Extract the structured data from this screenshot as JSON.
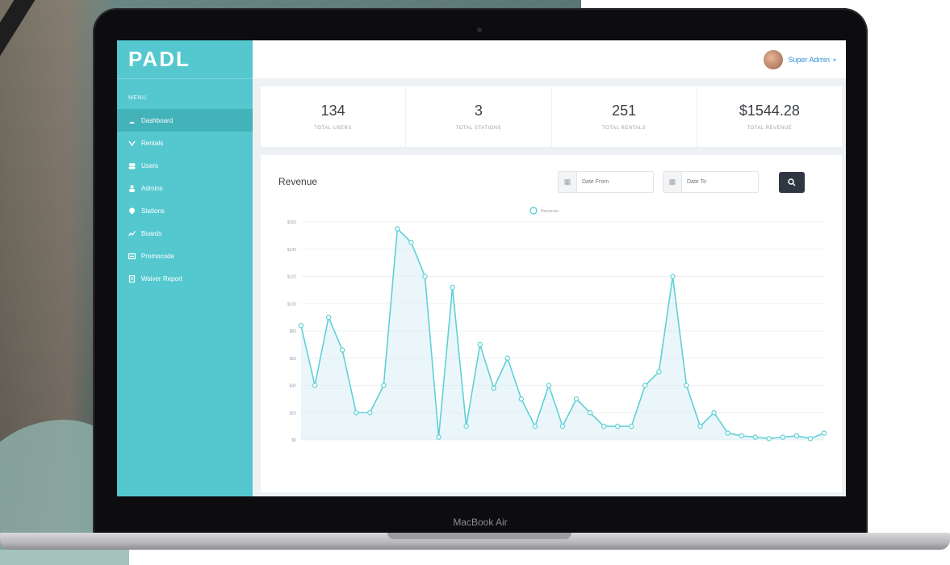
{
  "device": {
    "label": "MacBook Air"
  },
  "sidebar": {
    "logo": "PADL",
    "menu_title": "MENU",
    "items": [
      {
        "label": "Dashboard",
        "icon": "dashboard-icon",
        "active": true
      },
      {
        "label": "Rentals",
        "icon": "rentals-icon"
      },
      {
        "label": "Users",
        "icon": "users-icon"
      },
      {
        "label": "Admins",
        "icon": "admin-icon"
      },
      {
        "label": "Stations",
        "icon": "stations-icon"
      },
      {
        "label": "Boards",
        "icon": "boards-icon"
      },
      {
        "label": "Promocode",
        "icon": "promocode-icon"
      },
      {
        "label": "Waiver Report",
        "icon": "report-icon"
      }
    ]
  },
  "header": {
    "user_name": "Super Admin"
  },
  "stats": [
    {
      "value": "134",
      "label": "TOTAL USERS"
    },
    {
      "value": "3",
      "label": "TOTAL STATIONS"
    },
    {
      "value": "251",
      "label": "TOTAL RENTALS"
    },
    {
      "value": "$1544.28",
      "label": "TOTAL REVENUE"
    }
  ],
  "panel": {
    "title": "Revenue",
    "date_from_placeholder": "Date From",
    "date_to_placeholder": "Date To"
  },
  "colors": {
    "accent": "#55c8cf",
    "line": "#5fd1d6",
    "fill": "#dbeef8"
  },
  "chart_data": {
    "type": "line",
    "series": [
      {
        "name": "Revenue",
        "values": [
          84,
          40,
          90,
          66,
          20,
          20,
          40,
          155,
          145,
          120,
          2,
          112,
          10,
          70,
          38,
          60,
          30,
          10,
          40,
          10,
          30,
          20,
          10,
          10,
          10,
          40,
          50,
          120,
          40,
          10,
          20,
          5,
          3,
          2,
          1,
          2,
          3,
          1,
          5
        ]
      }
    ],
    "y_ticks": [
      "$0",
      "$20",
      "$40",
      "$60",
      "$80",
      "$100",
      "$120",
      "$140",
      "$160"
    ],
    "ylim": [
      0,
      160
    ],
    "grid": true,
    "legend": "top-center"
  }
}
